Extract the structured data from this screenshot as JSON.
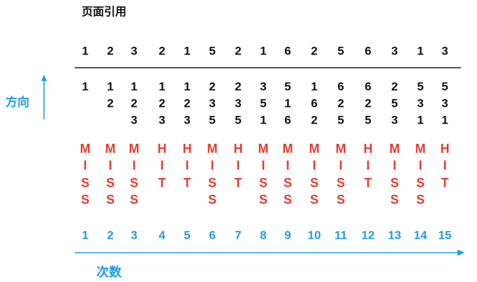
{
  "title": "页面引用",
  "direction_label": "方向",
  "count_label": "次数",
  "colors": {
    "text": "#111111",
    "result": "#e63a2e",
    "accent": "#1e9be6"
  },
  "icons": {
    "direction_arrow": "arrow-up-icon",
    "count_arrow": "arrow-right-icon"
  },
  "references": [
    1,
    2,
    3,
    2,
    1,
    5,
    2,
    1,
    6,
    2,
    5,
    6,
    3,
    1,
    3
  ],
  "frames": [
    [
      1
    ],
    [
      1,
      2
    ],
    [
      1,
      2,
      3
    ],
    [
      1,
      2,
      3
    ],
    [
      1,
      2,
      3
    ],
    [
      2,
      3,
      5
    ],
    [
      2,
      3,
      5
    ],
    [
      3,
      5,
      1
    ],
    [
      5,
      1,
      6
    ],
    [
      1,
      6,
      2
    ],
    [
      6,
      2,
      5
    ],
    [
      6,
      2,
      5
    ],
    [
      2,
      5,
      3
    ],
    [
      5,
      3,
      1
    ],
    [
      5,
      3,
      1
    ]
  ],
  "results": [
    "MISS",
    "MISS",
    "MISS",
    "HIT",
    "HIT",
    "MISS",
    "HIT",
    "MISS",
    "MISS",
    "MISS",
    "MISS",
    "HIT",
    "MISS",
    "MISS",
    "HIT"
  ],
  "steps": [
    1,
    2,
    3,
    4,
    5,
    6,
    7,
    8,
    9,
    10,
    11,
    12,
    13,
    14,
    15
  ]
}
